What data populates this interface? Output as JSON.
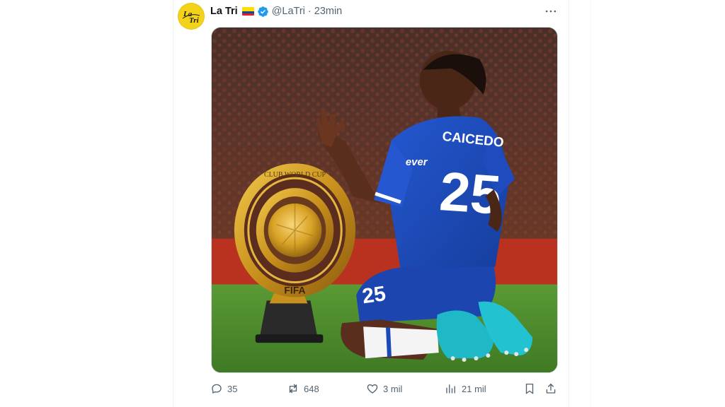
{
  "tweet": {
    "author_name": "La Tri",
    "author_handle": "@LaTri",
    "separator": "·",
    "timestamp": "23min",
    "avatar_text": "La Tri",
    "verified": true,
    "flag": "ecuador",
    "media": {
      "jersey_name": "CAICEDO",
      "jersey_number": "25",
      "sponsor": "ever",
      "shorts_number": "25",
      "trophy_base_text": "FIFA",
      "trophy_ring_text": "CLUB WORLD CUP"
    },
    "actions": {
      "replies": "35",
      "reposts": "648",
      "likes": "3 mil",
      "views": "21 mil"
    }
  },
  "colors": {
    "verified_blue": "#1d9bf0",
    "secondary_text": "#536471",
    "avatar_yellow": "#f3d21a",
    "jersey_blue": "#1c49b8",
    "boots_teal": "#1fb8c7",
    "pitch_green": "#4d8a2c",
    "trophy_gold": "#d9a326"
  },
  "icons": [
    "more-icon",
    "reply-icon",
    "repost-icon",
    "like-icon",
    "views-icon",
    "bookmark-icon",
    "share-icon",
    "verified-icon"
  ]
}
